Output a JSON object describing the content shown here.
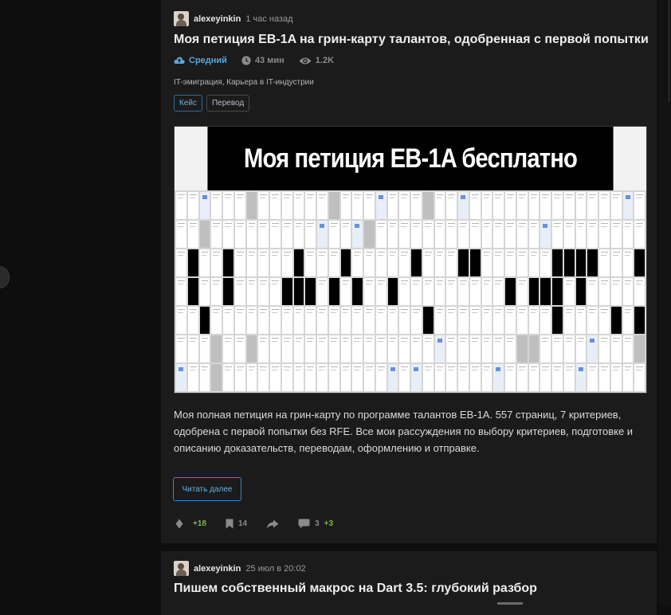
{
  "feed": {
    "posts": [
      {
        "author": "alexeyinkin",
        "time": "1 час назад",
        "title": "Моя петиция EB-1A на грин-карту талантов, одобренная с первой попытки",
        "complexity": "Средний",
        "reading_time": "43 мин",
        "views": "1.2K",
        "hubs": "IT-эмиграция, Карьера в IT-индустрии",
        "labels": [
          "Кейс",
          "Перевод"
        ],
        "cover_title": "Моя петиция EB-1A бесплатно",
        "excerpt": "Моя полная петиция на грин-карту по программе талантов EB-1A. 557 страниц, 7 критериев, одобрена с первой попытки без RFE. Все мои рассуждения по выбору критериев, подготовке и описанию доказательств, переводам, оформлению и отправке.",
        "read_more": "Читать далее",
        "votes": "+18",
        "bookmarks": "14",
        "comments": "3",
        "new_comments": "+3"
      },
      {
        "author": "alexeyinkin",
        "time": "25 июл в 20:02",
        "title": "Пишем собственный макрос на Dart 3.5: глубокий разбор"
      }
    ]
  },
  "colors": {
    "background": "#0e0e0e",
    "card": "#1b1b1c",
    "accent_blue": "#5aa9dd",
    "vote_green": "#7ab845"
  },
  "icons": [
    "cloud-level-icon",
    "clock-icon",
    "eye-icon",
    "vote-diamond-icon",
    "bookmark-icon",
    "share-arrow-icon",
    "comment-bubble-icon"
  ]
}
